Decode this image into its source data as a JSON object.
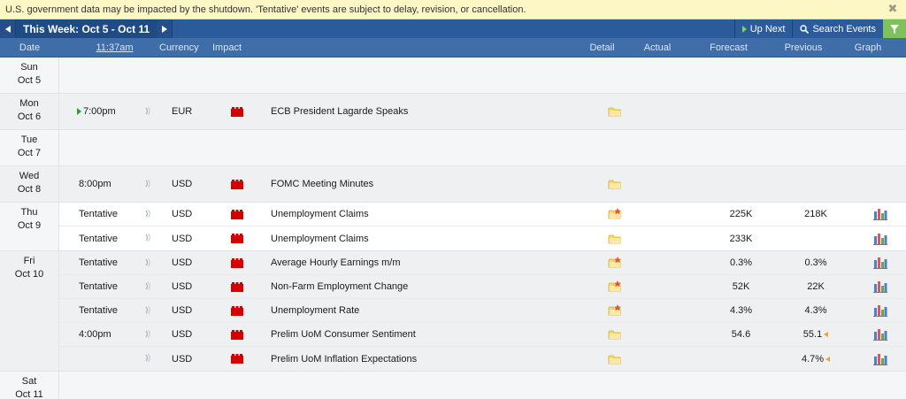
{
  "banner": {
    "text": "U.S. government data may be impacted by the shutdown. 'Tentative' events are subject to delay, revision, or cancellation."
  },
  "nav": {
    "week_label": "This Week: Oct 5 - Oct 11",
    "up_next_label": "Up Next",
    "search_label": "Search Events"
  },
  "header": {
    "date": "Date",
    "time": "11:37am",
    "currency": "Currency",
    "impact": "Impact",
    "detail": "Detail",
    "actual": "Actual",
    "forecast": "Forecast",
    "previous": "Previous",
    "graph": "Graph"
  },
  "colors": {
    "impact_high": "#d40000",
    "nav_bg": "#2b5b9b",
    "header_bg": "#3e6da8",
    "filter_green": "#7fc15a",
    "banner_bg": "#fdf7c6"
  },
  "days": [
    {
      "dow": "Sun",
      "date": "Oct 5",
      "events": []
    },
    {
      "dow": "Mon",
      "date": "Oct 6",
      "events": [
        {
          "time": "7:00pm",
          "next": true,
          "currency": "EUR",
          "impact": "high",
          "event": "ECB President Lagarde Speaks",
          "detail_icon": "folder-icon",
          "actual": "",
          "forecast": "",
          "previous": "",
          "revised": false,
          "graph": false
        }
      ]
    },
    {
      "dow": "Tue",
      "date": "Oct 7",
      "events": []
    },
    {
      "dow": "Wed",
      "date": "Oct 8",
      "events": [
        {
          "time": "8:00pm",
          "next": false,
          "currency": "USD",
          "impact": "high",
          "event": "FOMC Meeting Minutes",
          "detail_icon": "folder-icon",
          "actual": "",
          "forecast": "",
          "previous": "",
          "revised": false,
          "graph": false
        }
      ]
    },
    {
      "dow": "Thu",
      "date": "Oct 9",
      "events": [
        {
          "time": "Tentative",
          "next": false,
          "currency": "USD",
          "impact": "high",
          "event": "Unemployment Claims",
          "detail_icon": "folder-star-icon",
          "actual": "",
          "forecast": "225K",
          "previous": "218K",
          "revised": false,
          "graph": true
        },
        {
          "time": "Tentative",
          "next": false,
          "currency": "USD",
          "impact": "high",
          "event": "Unemployment Claims",
          "detail_icon": "folder-icon",
          "actual": "",
          "forecast": "233K",
          "previous": "",
          "revised": false,
          "graph": true
        }
      ]
    },
    {
      "dow": "Fri",
      "date": "Oct 10",
      "events": [
        {
          "time": "Tentative",
          "next": false,
          "currency": "USD",
          "impact": "high",
          "event": "Average Hourly Earnings m/m",
          "detail_icon": "folder-star-icon",
          "actual": "",
          "forecast": "0.3%",
          "previous": "0.3%",
          "revised": false,
          "graph": true
        },
        {
          "time": "Tentative",
          "next": false,
          "currency": "USD",
          "impact": "high",
          "event": "Non-Farm Employment Change",
          "detail_icon": "folder-star-icon",
          "actual": "",
          "forecast": "52K",
          "previous": "22K",
          "revised": false,
          "graph": true
        },
        {
          "time": "Tentative",
          "next": false,
          "currency": "USD",
          "impact": "high",
          "event": "Unemployment Rate",
          "detail_icon": "folder-star-icon",
          "actual": "",
          "forecast": "4.3%",
          "previous": "4.3%",
          "revised": false,
          "graph": true
        },
        {
          "time": "4:00pm",
          "next": false,
          "currency": "USD",
          "impact": "high",
          "event": "Prelim UoM Consumer Sentiment",
          "detail_icon": "folder-icon",
          "actual": "",
          "forecast": "54.6",
          "previous": "55.1",
          "revised": true,
          "graph": true
        },
        {
          "time": "",
          "next": false,
          "currency": "USD",
          "impact": "high",
          "event": "Prelim UoM Inflation Expectations",
          "detail_icon": "folder-icon",
          "actual": "",
          "forecast": "",
          "previous": "4.7%",
          "revised": true,
          "graph": true
        }
      ]
    },
    {
      "dow": "Sat",
      "date": "Oct 11",
      "events": []
    }
  ]
}
